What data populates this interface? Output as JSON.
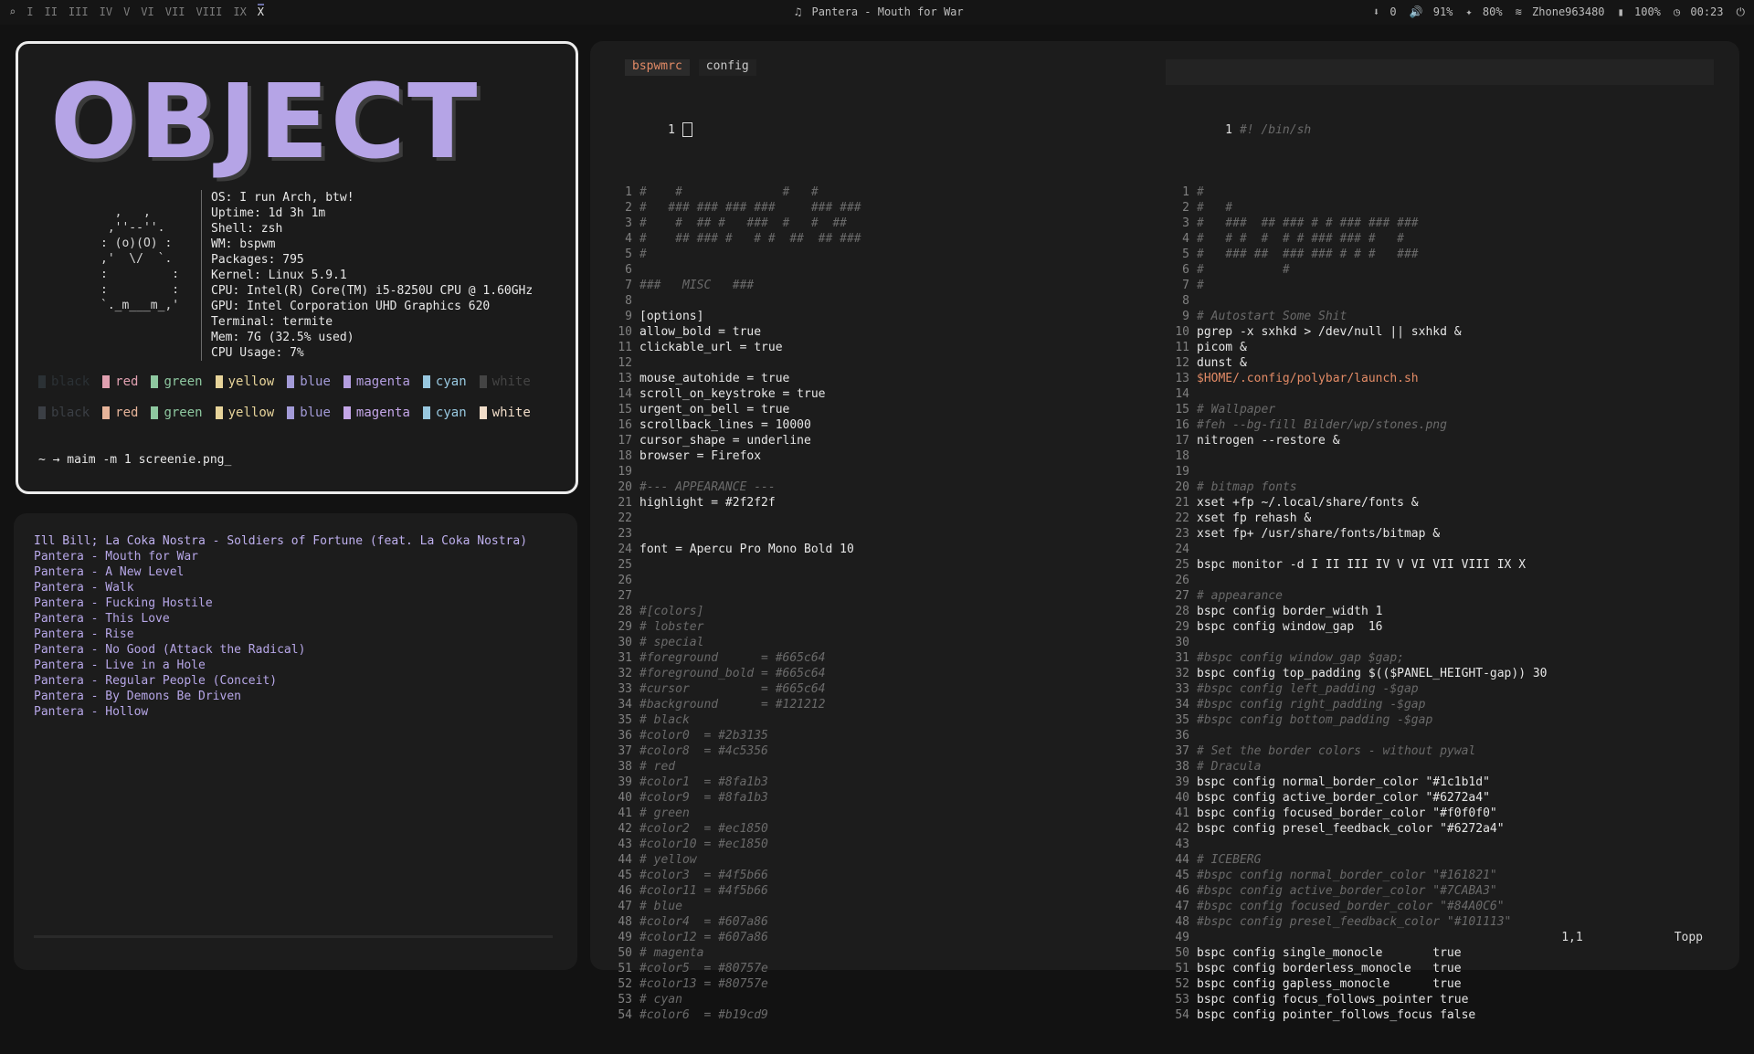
{
  "topbar": {
    "workspaces": [
      "I",
      "II",
      "III",
      "IV",
      "V",
      "VI",
      "VII",
      "VIII",
      "IX",
      "X"
    ],
    "active_workspace": "X",
    "now_playing": "Pantera - Mouth for War",
    "status": {
      "updates": "0",
      "volume": "91%",
      "brightness": "80%",
      "wifi": "Zhone963480",
      "battery": "100%",
      "time": "00:23"
    }
  },
  "fetch": {
    "logo": "OBJECT",
    "ascii_art": "  ,   ,\n ,''--''.\n: (o)(O) :\n,'  \\/  `.\n:         :\n:         :\n`._m___m_,'",
    "info": [
      "OS: I run Arch, btw!",
      "Uptime: 1d 3h 1m",
      "Shell: zsh",
      "WM: bspwm",
      "Packages: 795",
      "Kernel: Linux 5.9.1",
      "CPU: Intel(R) Core(TM) i5-8250U CPU @ 1.60GHz",
      "GPU: Intel Corporation UHD Graphics 620",
      "Terminal: termite",
      "Mem: 7G (32.5% used)",
      "CPU Usage: 7%"
    ],
    "colors_row1": [
      {
        "name": "black",
        "color": "#2b3135"
      },
      {
        "name": "red",
        "color": "#e0a0b0"
      },
      {
        "name": "green",
        "color": "#8ec8a0"
      },
      {
        "name": "yellow",
        "color": "#e7d49a"
      },
      {
        "name": "blue",
        "color": "#a39bd8"
      },
      {
        "name": "magenta",
        "color": "#b49ee0"
      },
      {
        "name": "cyan",
        "color": "#98c8e0"
      },
      {
        "name": "white",
        "color": "#444444"
      }
    ],
    "colors_row2": [
      {
        "name": "black",
        "color": "#3b3f45"
      },
      {
        "name": "red",
        "color": "#e7b49a"
      },
      {
        "name": "green",
        "color": "#8ec8a0"
      },
      {
        "name": "yellow",
        "color": "#e7d49a"
      },
      {
        "name": "blue",
        "color": "#a39bd8"
      },
      {
        "name": "magenta",
        "color": "#c4a6e8"
      },
      {
        "name": "cyan",
        "color": "#98c8e0"
      },
      {
        "name": "white",
        "color": "#f0dcc8"
      }
    ],
    "prompt": "~ → maim -m 1 screenie.png_"
  },
  "music": {
    "tracks": [
      "Ill Bill; La Coka Nostra - Soldiers of Fortune (feat. La Coka Nostra)",
      "Pantera - Mouth for War",
      "Pantera - A New Level",
      "Pantera - Walk",
      "Pantera - Fucking Hostile",
      "Pantera - This Love",
      "Pantera - Rise",
      "Pantera - No Good (Attack the Radical)",
      "Pantera - Live in a Hole",
      "Pantera - Regular People (Conceit)",
      "Pantera - By Demons Be Driven",
      "Pantera - Hollow"
    ]
  },
  "editor": {
    "tabs": [
      "bspwmrc",
      "config"
    ],
    "active_tab": "bspwmrc",
    "left_top_line": "1",
    "right_top_line": "1",
    "right_top_text": "#! /bin/sh",
    "status": {
      "position": "1,1",
      "scroll": "Topp"
    },
    "left_lines": [
      {
        "n": "1",
        "t": "#    #              #   #",
        "k": "comment"
      },
      {
        "n": "2",
        "t": "#   ### ### ### ###     ### ###",
        "k": "comment"
      },
      {
        "n": "3",
        "t": "#    #  ## #   ###  #   #  ##",
        "k": "comment"
      },
      {
        "n": "4",
        "t": "#    ## ### #   # #  ##  ## ###",
        "k": "comment"
      },
      {
        "n": "5",
        "t": "#",
        "k": "comment"
      },
      {
        "n": "6",
        "t": "",
        "k": "plain"
      },
      {
        "n": "7",
        "t": "###   MISC   ###",
        "k": "comment"
      },
      {
        "n": "8",
        "t": "",
        "k": "plain"
      },
      {
        "n": "9",
        "t": "[options]",
        "k": "plain"
      },
      {
        "n": "10",
        "t": "allow_bold = true",
        "k": "bool"
      },
      {
        "n": "11",
        "t": "clickable_url = true",
        "k": "bool"
      },
      {
        "n": "12",
        "t": "",
        "k": "plain"
      },
      {
        "n": "13",
        "t": "mouse_autohide = true",
        "k": "bool"
      },
      {
        "n": "14",
        "t": "scroll_on_keystroke = true",
        "k": "bool"
      },
      {
        "n": "15",
        "t": "urgent_on_bell = true",
        "k": "bool"
      },
      {
        "n": "16",
        "t": "scrollback_lines = 10000",
        "k": "num"
      },
      {
        "n": "17",
        "t": "cursor_shape = underline",
        "k": "plain"
      },
      {
        "n": "18",
        "t": "browser = Firefox",
        "k": "plain"
      },
      {
        "n": "19",
        "t": "",
        "k": "plain"
      },
      {
        "n": "20",
        "t": "#--- APPEARANCE ---",
        "k": "comment"
      },
      {
        "n": "21",
        "t": "highlight = #2f2f2f",
        "k": "plain"
      },
      {
        "n": "22",
        "t": "",
        "k": "plain"
      },
      {
        "n": "23",
        "t": "",
        "k": "plain"
      },
      {
        "n": "24",
        "t": "font = Apercu Pro Mono Bold 10",
        "k": "num"
      },
      {
        "n": "25",
        "t": "",
        "k": "plain"
      },
      {
        "n": "26",
        "t": "",
        "k": "plain"
      },
      {
        "n": "27",
        "t": "",
        "k": "plain"
      },
      {
        "n": "28",
        "t": "#[colors]",
        "k": "comment"
      },
      {
        "n": "29",
        "t": "# lobster",
        "k": "comment"
      },
      {
        "n": "30",
        "t": "# special",
        "k": "comment"
      },
      {
        "n": "31",
        "t": "#foreground      = #665c64",
        "k": "comment"
      },
      {
        "n": "32",
        "t": "#foreground_bold = #665c64",
        "k": "comment"
      },
      {
        "n": "33",
        "t": "#cursor          = #665c64",
        "k": "comment"
      },
      {
        "n": "34",
        "t": "#background      = #121212",
        "k": "comment"
      },
      {
        "n": "35",
        "t": "# black",
        "k": "comment"
      },
      {
        "n": "36",
        "t": "#color0  = #2b3135",
        "k": "comment"
      },
      {
        "n": "37",
        "t": "#color8  = #4c5356",
        "k": "comment"
      },
      {
        "n": "38",
        "t": "# red",
        "k": "comment"
      },
      {
        "n": "39",
        "t": "#color1  = #8fa1b3",
        "k": "comment"
      },
      {
        "n": "40",
        "t": "#color9  = #8fa1b3",
        "k": "comment"
      },
      {
        "n": "41",
        "t": "# green",
        "k": "comment"
      },
      {
        "n": "42",
        "t": "#color2  = #ec1850",
        "k": "comment"
      },
      {
        "n": "43",
        "t": "#color10 = #ec1850",
        "k": "comment"
      },
      {
        "n": "44",
        "t": "# yellow",
        "k": "comment"
      },
      {
        "n": "45",
        "t": "#color3  = #4f5b66",
        "k": "comment"
      },
      {
        "n": "46",
        "t": "#color11 = #4f5b66",
        "k": "comment"
      },
      {
        "n": "47",
        "t": "# blue",
        "k": "comment"
      },
      {
        "n": "48",
        "t": "#color4  = #607a86",
        "k": "comment"
      },
      {
        "n": "49",
        "t": "#color12 = #607a86",
        "k": "comment"
      },
      {
        "n": "50",
        "t": "# magenta",
        "k": "comment"
      },
      {
        "n": "51",
        "t": "#color5  = #80757e",
        "k": "comment"
      },
      {
        "n": "52",
        "t": "#color13 = #80757e",
        "k": "comment"
      },
      {
        "n": "53",
        "t": "# cyan",
        "k": "comment"
      },
      {
        "n": "54",
        "t": "#color6  = #b19cd9",
        "k": "comment"
      }
    ],
    "right_lines": [
      {
        "n": "1",
        "t": "#",
        "k": "comment"
      },
      {
        "n": "2",
        "t": "#   #",
        "k": "comment"
      },
      {
        "n": "3",
        "t": "#   ###  ## ### # # ### ### ###",
        "k": "comment"
      },
      {
        "n": "4",
        "t": "#   # #  #  # # ### ### #   #",
        "k": "comment"
      },
      {
        "n": "5",
        "t": "#   ### ##  ### ### # # #   ###",
        "k": "comment"
      },
      {
        "n": "6",
        "t": "#           #",
        "k": "comment"
      },
      {
        "n": "7",
        "t": "#",
        "k": "comment"
      },
      {
        "n": "8",
        "t": "",
        "k": "plain"
      },
      {
        "n": "9",
        "t": "# Autostart Some Shit",
        "k": "comment"
      },
      {
        "n": "10",
        "t": "pgrep -x sxhkd > /dev/null || sxhkd &",
        "k": "plain"
      },
      {
        "n": "11",
        "t": "picom &",
        "k": "plain"
      },
      {
        "n": "12",
        "t": "dunst &",
        "k": "plain"
      },
      {
        "n": "13",
        "t": "$HOME/.config/polybar/launch.sh",
        "k": "var"
      },
      {
        "n": "14",
        "t": "",
        "k": "plain"
      },
      {
        "n": "15",
        "t": "# Wallpaper",
        "k": "comment"
      },
      {
        "n": "16",
        "t": "#feh --bg-fill Bilder/wp/stones.png",
        "k": "comment"
      },
      {
        "n": "17",
        "t": "nitrogen --restore &",
        "k": "plain"
      },
      {
        "n": "18",
        "t": "",
        "k": "plain"
      },
      {
        "n": "19",
        "t": "",
        "k": "plain"
      },
      {
        "n": "20",
        "t": "# bitmap fonts",
        "k": "comment"
      },
      {
        "n": "21",
        "t": "xset +fp ~/.local/share/fonts &",
        "k": "plain"
      },
      {
        "n": "22",
        "t": "xset fp rehash &",
        "k": "plain"
      },
      {
        "n": "23",
        "t": "xset fp+ /usr/share/fonts/bitmap &",
        "k": "plain"
      },
      {
        "n": "24",
        "t": "",
        "k": "plain"
      },
      {
        "n": "25",
        "t": "bspc monitor -d I II III IV V VI VII VIII IX X",
        "k": "plain"
      },
      {
        "n": "26",
        "t": "",
        "k": "plain"
      },
      {
        "n": "27",
        "t": "# appearance",
        "k": "comment"
      },
      {
        "n": "28",
        "t": "bspc config border_width 1",
        "k": "num"
      },
      {
        "n": "29",
        "t": "bspc config window_gap  16",
        "k": "num"
      },
      {
        "n": "30",
        "t": "",
        "k": "plain"
      },
      {
        "n": "31",
        "t": "#bspc config window_gap $gap;",
        "k": "comment"
      },
      {
        "n": "32",
        "t": "bspc config top_padding $(($PANEL_HEIGHT-gap)) 30",
        "k": "num"
      },
      {
        "n": "33",
        "t": "#bspc config left_padding -$gap",
        "k": "comment"
      },
      {
        "n": "34",
        "t": "#bspc config right_padding -$gap",
        "k": "comment"
      },
      {
        "n": "35",
        "t": "#bspc config bottom_padding -$gap",
        "k": "comment"
      },
      {
        "n": "36",
        "t": "",
        "k": "plain"
      },
      {
        "n": "37",
        "t": "# Set the border colors - without pywal",
        "k": "comment"
      },
      {
        "n": "38",
        "t": "# Dracula",
        "k": "comment"
      },
      {
        "n": "39",
        "t": "bspc config normal_border_color \"#1c1b1d\"",
        "k": "plain"
      },
      {
        "n": "40",
        "t": "bspc config active_border_color \"#6272a4\"",
        "k": "plain"
      },
      {
        "n": "41",
        "t": "bspc config focused_border_color \"#f0f0f0\"",
        "k": "plain"
      },
      {
        "n": "42",
        "t": "bspc config presel_feedback_color \"#6272a4\"",
        "k": "plain"
      },
      {
        "n": "43",
        "t": "",
        "k": "plain"
      },
      {
        "n": "44",
        "t": "# ICEBERG",
        "k": "comment"
      },
      {
        "n": "45",
        "t": "#bspc config normal_border_color \"#161821\"",
        "k": "comment"
      },
      {
        "n": "46",
        "t": "#bspc config active_border_color \"#7CABA3\"",
        "k": "comment"
      },
      {
        "n": "47",
        "t": "#bspc config focused_border_color \"#84A0C6\"",
        "k": "comment"
      },
      {
        "n": "48",
        "t": "#bspc config presel_feedback_color \"#101113\"",
        "k": "comment"
      },
      {
        "n": "49",
        "t": "",
        "k": "plain"
      },
      {
        "n": "50",
        "t": "bspc config single_monocle       true",
        "k": "bool"
      },
      {
        "n": "51",
        "t": "bspc config borderless_monocle   true",
        "k": "bool"
      },
      {
        "n": "52",
        "t": "bspc config gapless_monocle      true",
        "k": "bool"
      },
      {
        "n": "53",
        "t": "bspc config focus_follows_pointer true",
        "k": "bool"
      },
      {
        "n": "54",
        "t": "bspc config pointer_follows_focus false",
        "k": "bool"
      }
    ]
  }
}
